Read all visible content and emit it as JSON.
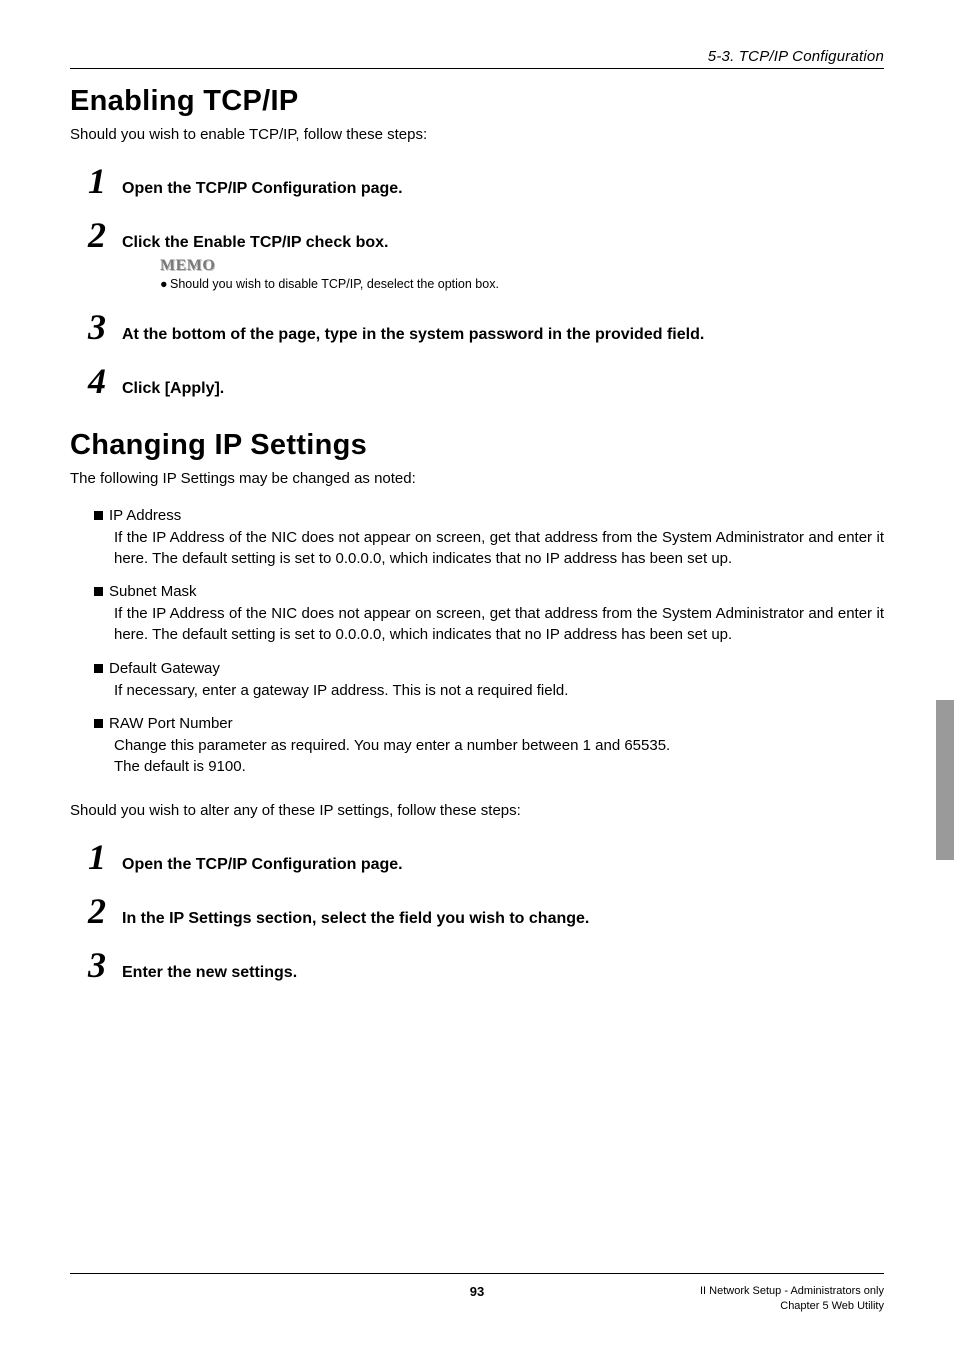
{
  "header": {
    "running_head": "5-3. TCP/IP Configuration"
  },
  "section1": {
    "title": "Enabling TCP/IP",
    "intro": "Should you wish to enable TCP/IP, follow these steps:",
    "steps": [
      {
        "num": "1",
        "text": "Open the TCP/IP Configuration page."
      },
      {
        "num": "2",
        "text": "Click the Enable TCP/IP check box."
      },
      {
        "num": "3",
        "text": "At the bottom of the page, type in the system password in the provided field."
      },
      {
        "num": "4",
        "text": "Click [Apply]."
      }
    ],
    "memo": {
      "label": "MEMO",
      "line": "Should you wish to disable TCP/IP, deselect the option box."
    }
  },
  "section2": {
    "title": "Changing IP Settings",
    "intro": "The following IP Settings may be changed as noted:",
    "bullets": [
      {
        "head": "IP Address",
        "body": "If the IP Address of the NIC does not appear on screen, get that address from the System Administrator and enter it here. The default setting is set to 0.0.0.0, which indicates that no IP address has been set up."
      },
      {
        "head": "Subnet Mask",
        "body": "If the IP Address of the NIC does not appear on screen, get that address from the System Administrator and enter it here. The default setting is set to 0.0.0.0, which indicates that no IP address has been set up."
      },
      {
        "head": "Default Gateway",
        "body": "If necessary, enter a gateway IP address. This is not a required field."
      },
      {
        "head": "RAW Port Number",
        "body": "Change this parameter as required. You may enter a number between 1 and 65535.",
        "body2": "The default is 9100."
      }
    ],
    "after": "Should you wish to alter any of these IP settings, follow these steps:",
    "steps": [
      {
        "num": "1",
        "text": "Open the TCP/IP Configuration page."
      },
      {
        "num": "2",
        "text": "In the IP Settings section, select the field you wish to change."
      },
      {
        "num": "3",
        "text": "Enter the new settings."
      }
    ]
  },
  "footer": {
    "page_number": "93",
    "right_line1": "II Network Setup - Administrators only",
    "right_line2": "Chapter 5 Web Utility"
  }
}
